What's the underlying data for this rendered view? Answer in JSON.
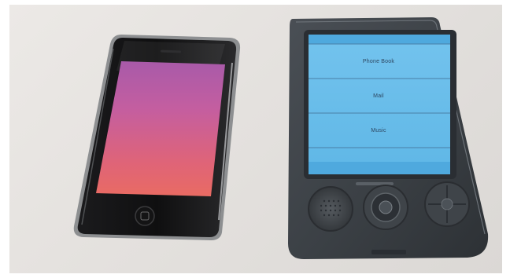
{
  "scene": {
    "description_colors": {
      "wall": "#e6e3e0",
      "phone_left_screen_top": "#b05aa5",
      "phone_left_screen_bottom": "#e86a66",
      "phone_right_screen": "#5cb9e8",
      "device_body": "#3f4449"
    }
  },
  "right_device": {
    "menu": [
      {
        "label": "Phone Book"
      },
      {
        "label": "Mail"
      },
      {
        "label": "Music"
      }
    ]
  }
}
